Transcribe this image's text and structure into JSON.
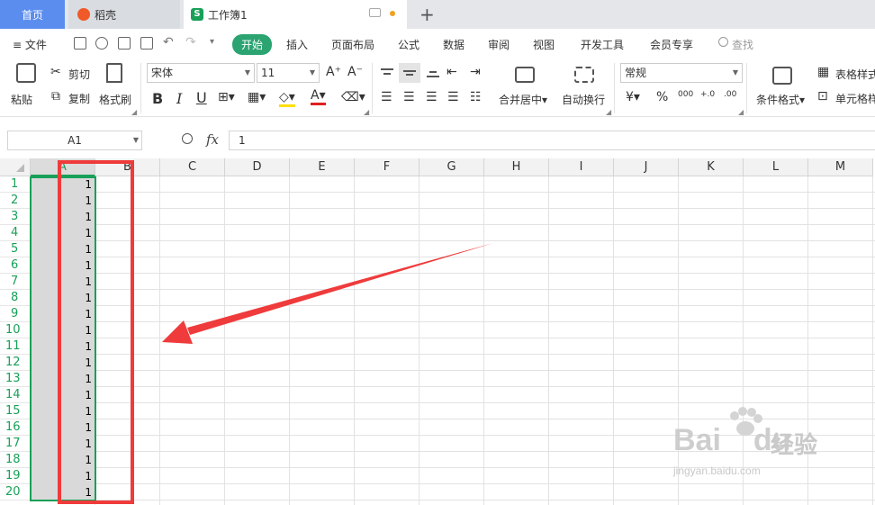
{
  "tabs": {
    "home": "首页",
    "daoke": "稻壳",
    "workbook": "工作簿1",
    "add": "+"
  },
  "menu": {
    "file": "≡ 文件",
    "items": [
      "开始",
      "插入",
      "页面布局",
      "公式",
      "数据",
      "审阅",
      "视图",
      "开发工具",
      "会员专享"
    ],
    "search": "查找"
  },
  "ribbon": {
    "paste": "粘贴",
    "cut": "剪切",
    "copy": "复制",
    "format_painter": "格式刷",
    "font_name": "宋体",
    "font_size": "11",
    "grow_font": "A⁺",
    "shrink_font": "A⁻",
    "bold": "B",
    "italic": "I",
    "underline": "U",
    "merge_center": "合并居中",
    "wrap_text": "自动换行",
    "number_format": "常规",
    "currency": "¥",
    "percent": "%",
    "thousands": "000",
    "inc_decimal": "+.0",
    "dec_decimal": ".00",
    "conditional_format": "条件格式",
    "table_style": "表格样式",
    "cell_style": "单元格样式",
    "font_color": "A"
  },
  "formula_bar": {
    "name_box": "A1",
    "fx": "fx",
    "value": "1"
  },
  "sheet": {
    "columns": [
      "A",
      "B",
      "C",
      "D",
      "E",
      "F",
      "G",
      "H",
      "I",
      "J",
      "K",
      "L",
      "M"
    ],
    "rows": [
      "1",
      "2",
      "3",
      "4",
      "5",
      "6",
      "7",
      "8",
      "9",
      "10",
      "11",
      "12",
      "13",
      "14",
      "15",
      "16",
      "17",
      "18",
      "19",
      "20"
    ],
    "column_a_values": [
      "1",
      "1",
      "1",
      "1",
      "1",
      "1",
      "1",
      "1",
      "1",
      "1",
      "1",
      "1",
      "1",
      "1",
      "1",
      "1",
      "1",
      "1",
      "1",
      "1"
    ]
  },
  "watermark": {
    "brand": "Bai",
    "brand2": "du",
    "cn": "经验",
    "url": "jingyan.baidu.com"
  },
  "colors": {
    "accent": "#18a058",
    "tab_active": "#5b8def",
    "annotation": "#ef3b3b",
    "selected_fill": "#d9d9d9"
  }
}
